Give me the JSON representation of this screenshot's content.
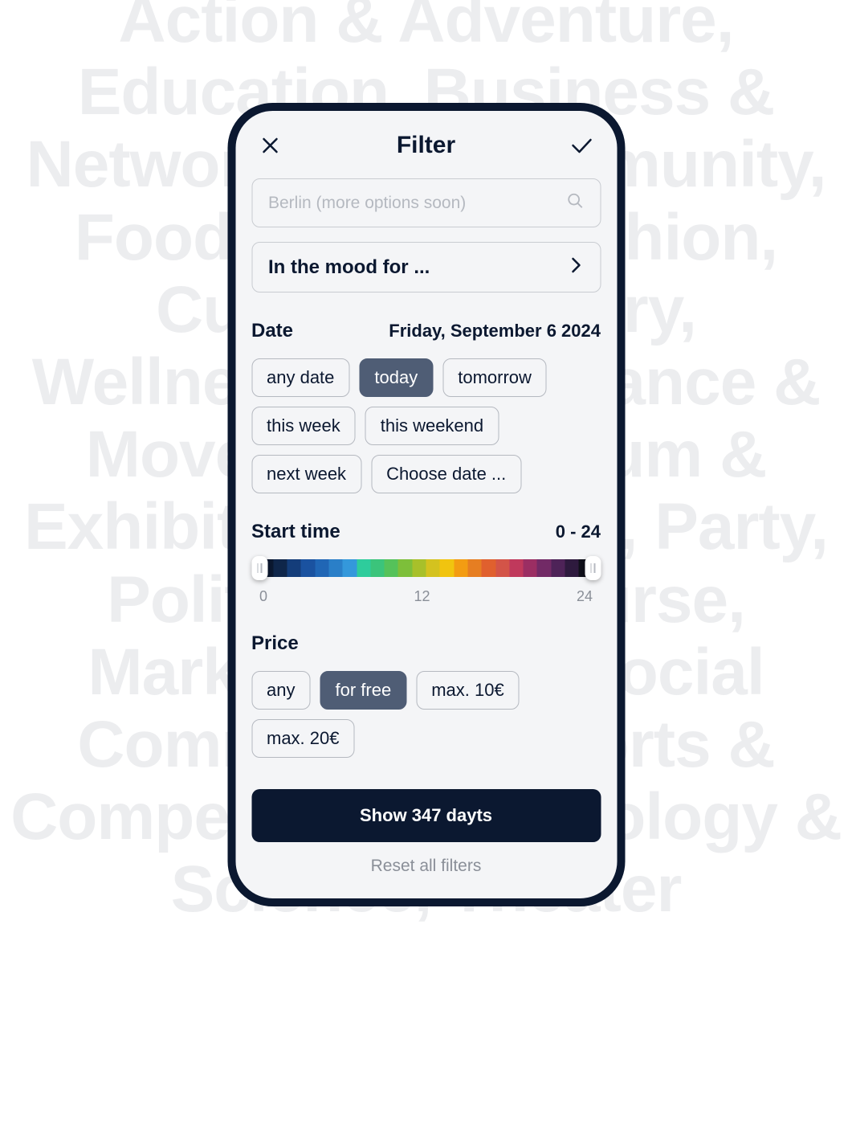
{
  "background_text": "Action & Adventure, Education, Business & Networking & Community, Food & Drink, Fashion, Culture & History, Wellness, Music, Dance & Movement, Museum & Exhibition, Outdoor, Party, Politics & Discourse, Markets, Tours, Social Commitment, Sports & Competition, Technology & Science, Theater",
  "header": {
    "title": "Filter"
  },
  "location": {
    "placeholder": "Berlin (more options soon)"
  },
  "mood": {
    "label": "In the mood for ..."
  },
  "date": {
    "label": "Date",
    "value": "Friday, September 6 2024",
    "options": [
      {
        "label": "any date",
        "active": false
      },
      {
        "label": "today",
        "active": true
      },
      {
        "label": "tomorrow",
        "active": false
      },
      {
        "label": "this week",
        "active": false
      },
      {
        "label": "this weekend",
        "active": false
      },
      {
        "label": "next week",
        "active": false
      },
      {
        "label": "Choose date ...",
        "active": false
      }
    ]
  },
  "start_time": {
    "label": "Start time",
    "value": "0 - 24",
    "ticks": [
      "0",
      "12",
      "24"
    ],
    "colors": [
      "#0b1830",
      "#0f264a",
      "#143d7a",
      "#1a52a0",
      "#2066b5",
      "#2a7fc8",
      "#3498db",
      "#2ecc9c",
      "#3bc47b",
      "#55c25a",
      "#7dbf3a",
      "#a8c02a",
      "#d4c21f",
      "#f1c40f",
      "#f39c12",
      "#e67e22",
      "#e0602e",
      "#d35448",
      "#c0395c",
      "#9b2e63",
      "#722a66",
      "#4e2358",
      "#2e1a3e",
      "#10101a"
    ]
  },
  "price": {
    "label": "Price",
    "options": [
      {
        "label": "any",
        "active": false
      },
      {
        "label": "for free",
        "active": true
      },
      {
        "label": "max. 10€",
        "active": false
      },
      {
        "label": "max. 20€",
        "active": false
      }
    ]
  },
  "footer": {
    "show_label": "Show 347 dayts",
    "reset_label": "Reset all filters"
  }
}
